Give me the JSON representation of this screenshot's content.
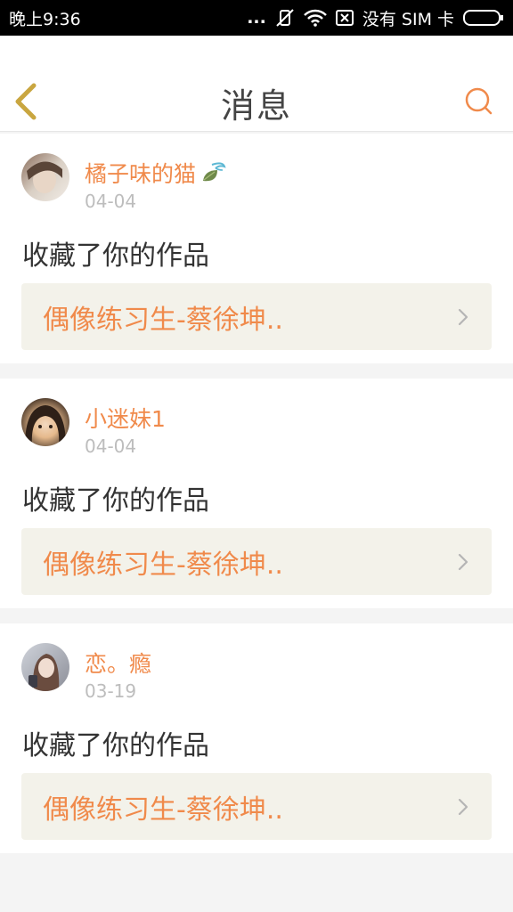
{
  "status_bar": {
    "time": "晚上9:36",
    "dots": "...",
    "carrier": "没有 SIM 卡"
  },
  "header": {
    "title": "消息",
    "back_icon": "chevron-left-icon",
    "search_icon": "search-icon"
  },
  "colors": {
    "accent": "#f08a4b",
    "back_icon": "#c9a640",
    "link_bg": "#f3f2ea"
  },
  "messages": [
    {
      "username": "橘子味的猫",
      "date": "04-04",
      "action": "收藏了你的作品",
      "work_title": "偶像练习生-蔡徐坤.."
    },
    {
      "username": "小迷妹1",
      "date": "04-04",
      "action": "收藏了你的作品",
      "work_title": "偶像练习生-蔡徐坤.."
    },
    {
      "username": "恋。瘾",
      "date": "03-19",
      "action": "收藏了你的作品",
      "work_title": "偶像练习生-蔡徐坤.."
    }
  ]
}
